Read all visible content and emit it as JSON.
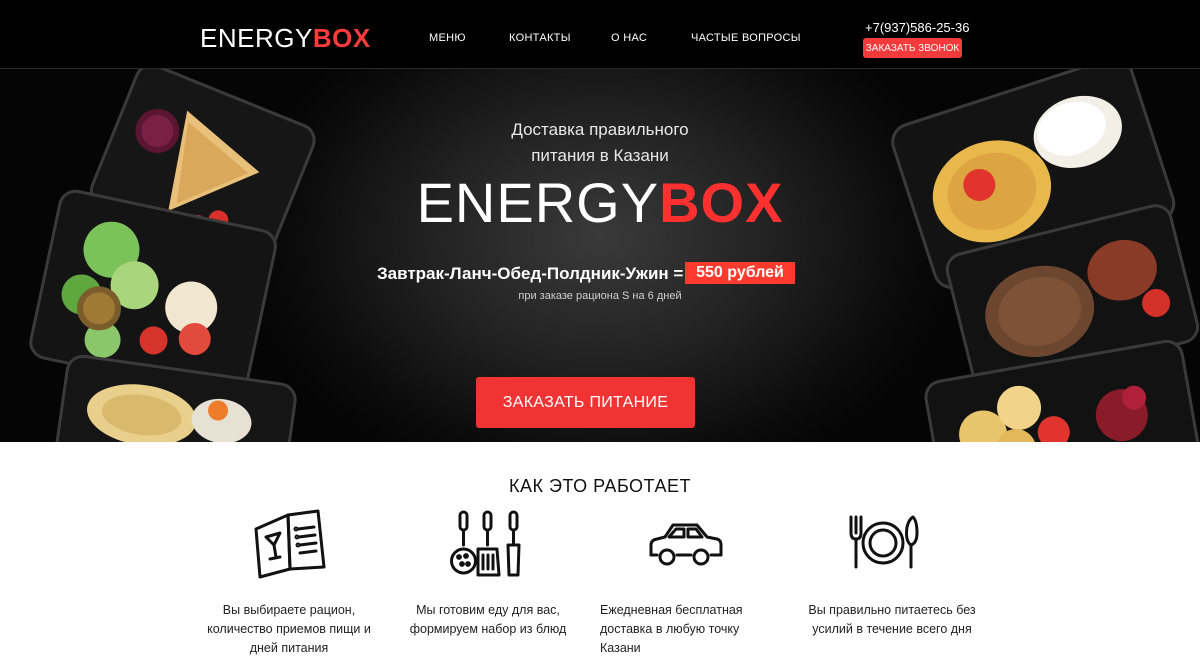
{
  "header": {
    "logo_energy": "ENERGY",
    "logo_box": "BOX",
    "nav": [
      "МЕНЮ",
      "КОНТАКТЫ",
      "О НАС",
      "ЧАСТЫЕ ВОПРОСЫ"
    ],
    "phone": "+7(937)586-25-36",
    "call_button": "ЗАКАЗАТЬ ЗВОНОК"
  },
  "hero": {
    "subtitle_line1": "Доставка правильного",
    "subtitle_line2": "питания в Казани",
    "logo_energy": "ENERGY",
    "logo_box": "BOX",
    "meals": "Завтрак-Ланч-Обед-Полдник-Ужин =",
    "price": "550 рублей",
    "price_note": "при заказе рациона S на 6 дней",
    "order_button": "ЗАКАЗАТЬ ПИТАНИЕ"
  },
  "how": {
    "title": "КАК ЭТО РАБОТАЕТ",
    "steps": [
      {
        "icon": "menu-book-icon",
        "lines": [
          "Вы выбираете рацион,",
          "количество приемов пищи и",
          "дней питания"
        ]
      },
      {
        "icon": "kitchen-utensils-icon",
        "lines": [
          "Мы готовим еду для вас,",
          "формируем набор из блюд"
        ]
      },
      {
        "icon": "car-icon",
        "lines": [
          "Ежедневная бесплатная",
          "доставка в любую точку",
          "Казани"
        ]
      },
      {
        "icon": "plate-cutlery-icon",
        "lines": [
          "Вы правильно питаетесь без",
          "усилий в течение всего дня"
        ]
      }
    ]
  },
  "colors": {
    "accent": "#f23333",
    "header_bg": "#000000"
  }
}
